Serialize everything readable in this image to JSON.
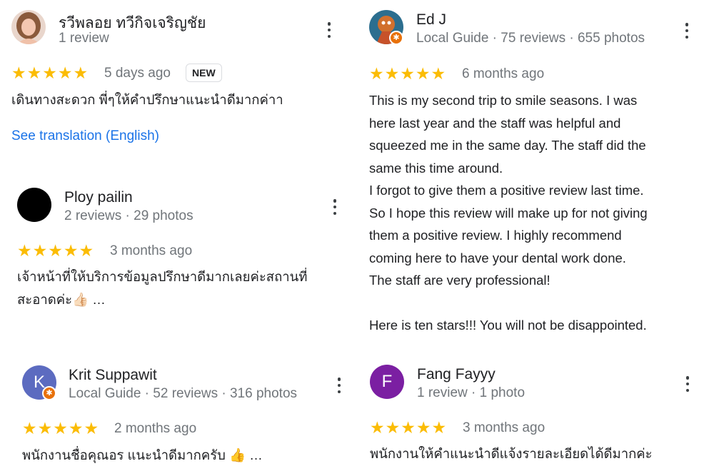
{
  "reviews": [
    {
      "name": "รวีพลอย ทวีกิจเจริญชัย",
      "meta": "1 review",
      "date": "5 days ago",
      "badge": "NEW",
      "text": [
        "เดินทางสะดวก พี่ๆให้คำปรึกษาแนะนำดีมากค่าา"
      ],
      "translation_link": "See translation (English)"
    },
    {
      "name": "Ploy pailin",
      "meta": "2 reviews · 29 photos",
      "date": "3 months ago",
      "text": [
        "เจ้าหน้าที่ให้บริการข้อมูลปรึกษาดีมากเลยค่ะสถานที่",
        "สะอาดค่ะ👍🏻 …"
      ]
    },
    {
      "name": "Krit Suppawit",
      "avatar_letter": "K",
      "meta": "Local Guide · 52 reviews · 316 photos",
      "date": "2 months ago",
      "text": [
        "พนักงานชื่อคุณอร แนะนำดีมากครับ 👍 …"
      ]
    },
    {
      "name": "Ed J",
      "meta": "Local Guide · 75 reviews · 655 photos",
      "date": "6 months ago",
      "text": [
        "This is my second trip to smile seasons. I was",
        "here last year and the staff was helpful and",
        "squeezed me in the same day. The staff did the",
        "same this time around.",
        "I forgot to give them a positive review last time.",
        "So I hope this review will make up for not giving",
        "them a positive review. I highly recommend",
        "coming here to have your dental work done.",
        "The staff are very professional!",
        "",
        "Here is ten stars!!! You will not be disappointed."
      ]
    },
    {
      "name": "Fang Fayyy",
      "avatar_letter": "F",
      "meta": "1 review · 1 photo",
      "date": "3 months ago",
      "text": [
        "พนักงานให้คำแนะนำดีแจ้งรายละเอียดได้ดีมากค่ะ"
      ]
    }
  ],
  "stars_glyph": "★★★★★",
  "icons": {
    "more": "more-vert-icon",
    "guide": "local-guide-badge-icon",
    "star": "star-icon"
  },
  "colors": {
    "star": "#fbbc04",
    "link": "#1a73e8",
    "muted": "#70757a",
    "krit_avatar": "#5c6bc0",
    "fang_avatar": "#7b1fa2",
    "guide_badge": "#e8710a"
  }
}
